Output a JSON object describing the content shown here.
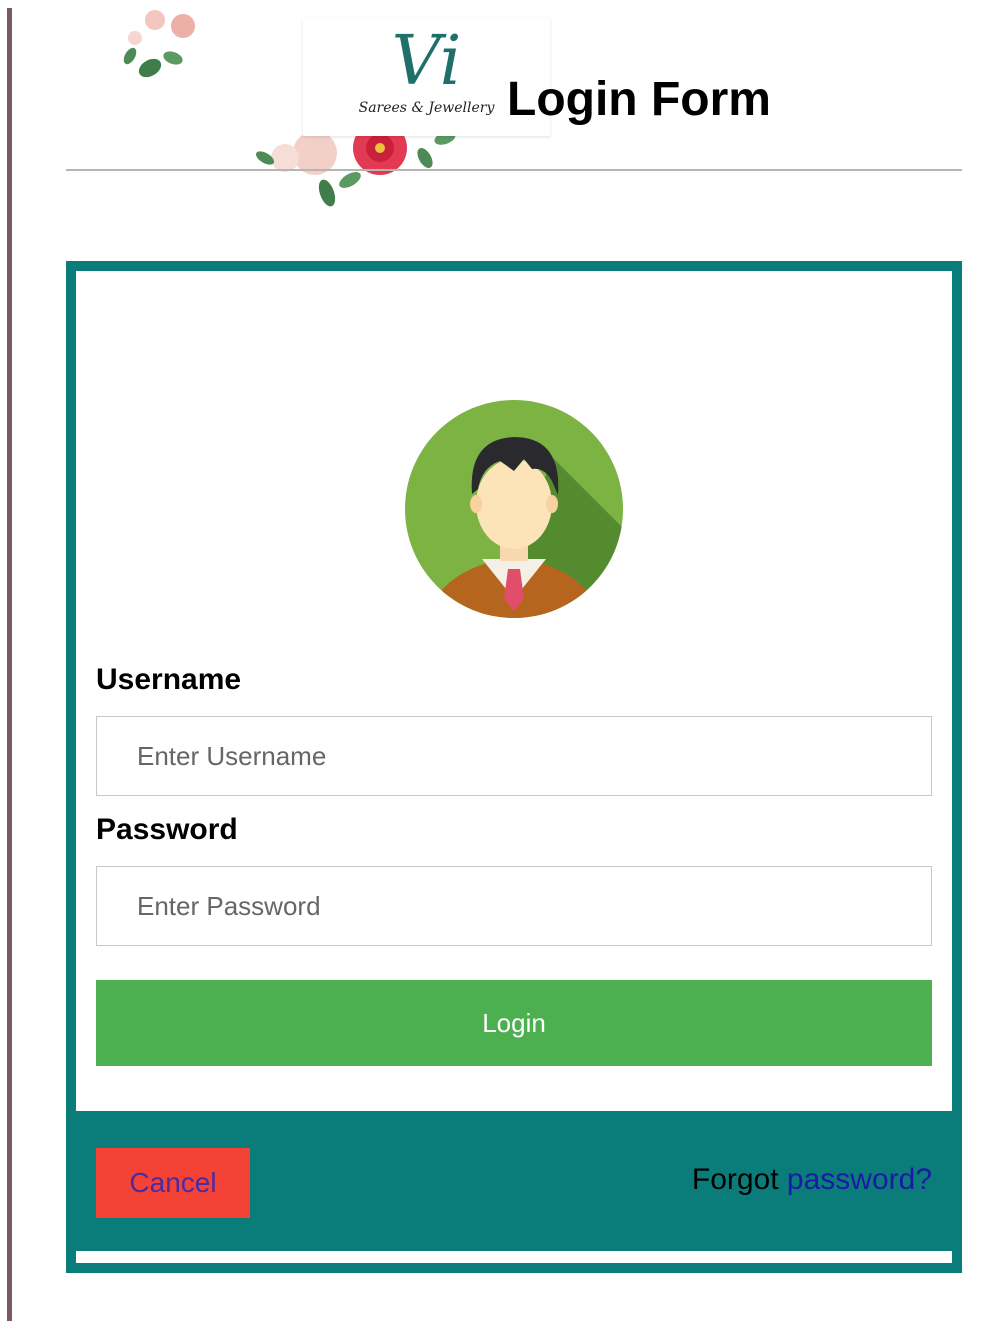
{
  "brand": {
    "logo_mark": "Vi",
    "logo_subtitle": "Sarees & Jewellery"
  },
  "header": {
    "title": "Login Form"
  },
  "form": {
    "username_label": "Username",
    "username_placeholder": "Enter Username",
    "password_label": "Password",
    "password_placeholder": "Enter Password",
    "login_label": "Login",
    "cancel_label": "Cancel",
    "forgot_prefix": "Forgot ",
    "forgot_link": "password?"
  },
  "colors": {
    "accent_teal": "#0a7d7a",
    "login_green": "#4caf50",
    "cancel_red": "#f44336",
    "link_blue": "#1a1aa6"
  },
  "icons": {
    "avatar": "user-avatar-icon",
    "flowers": "floral-decoration-icon"
  }
}
